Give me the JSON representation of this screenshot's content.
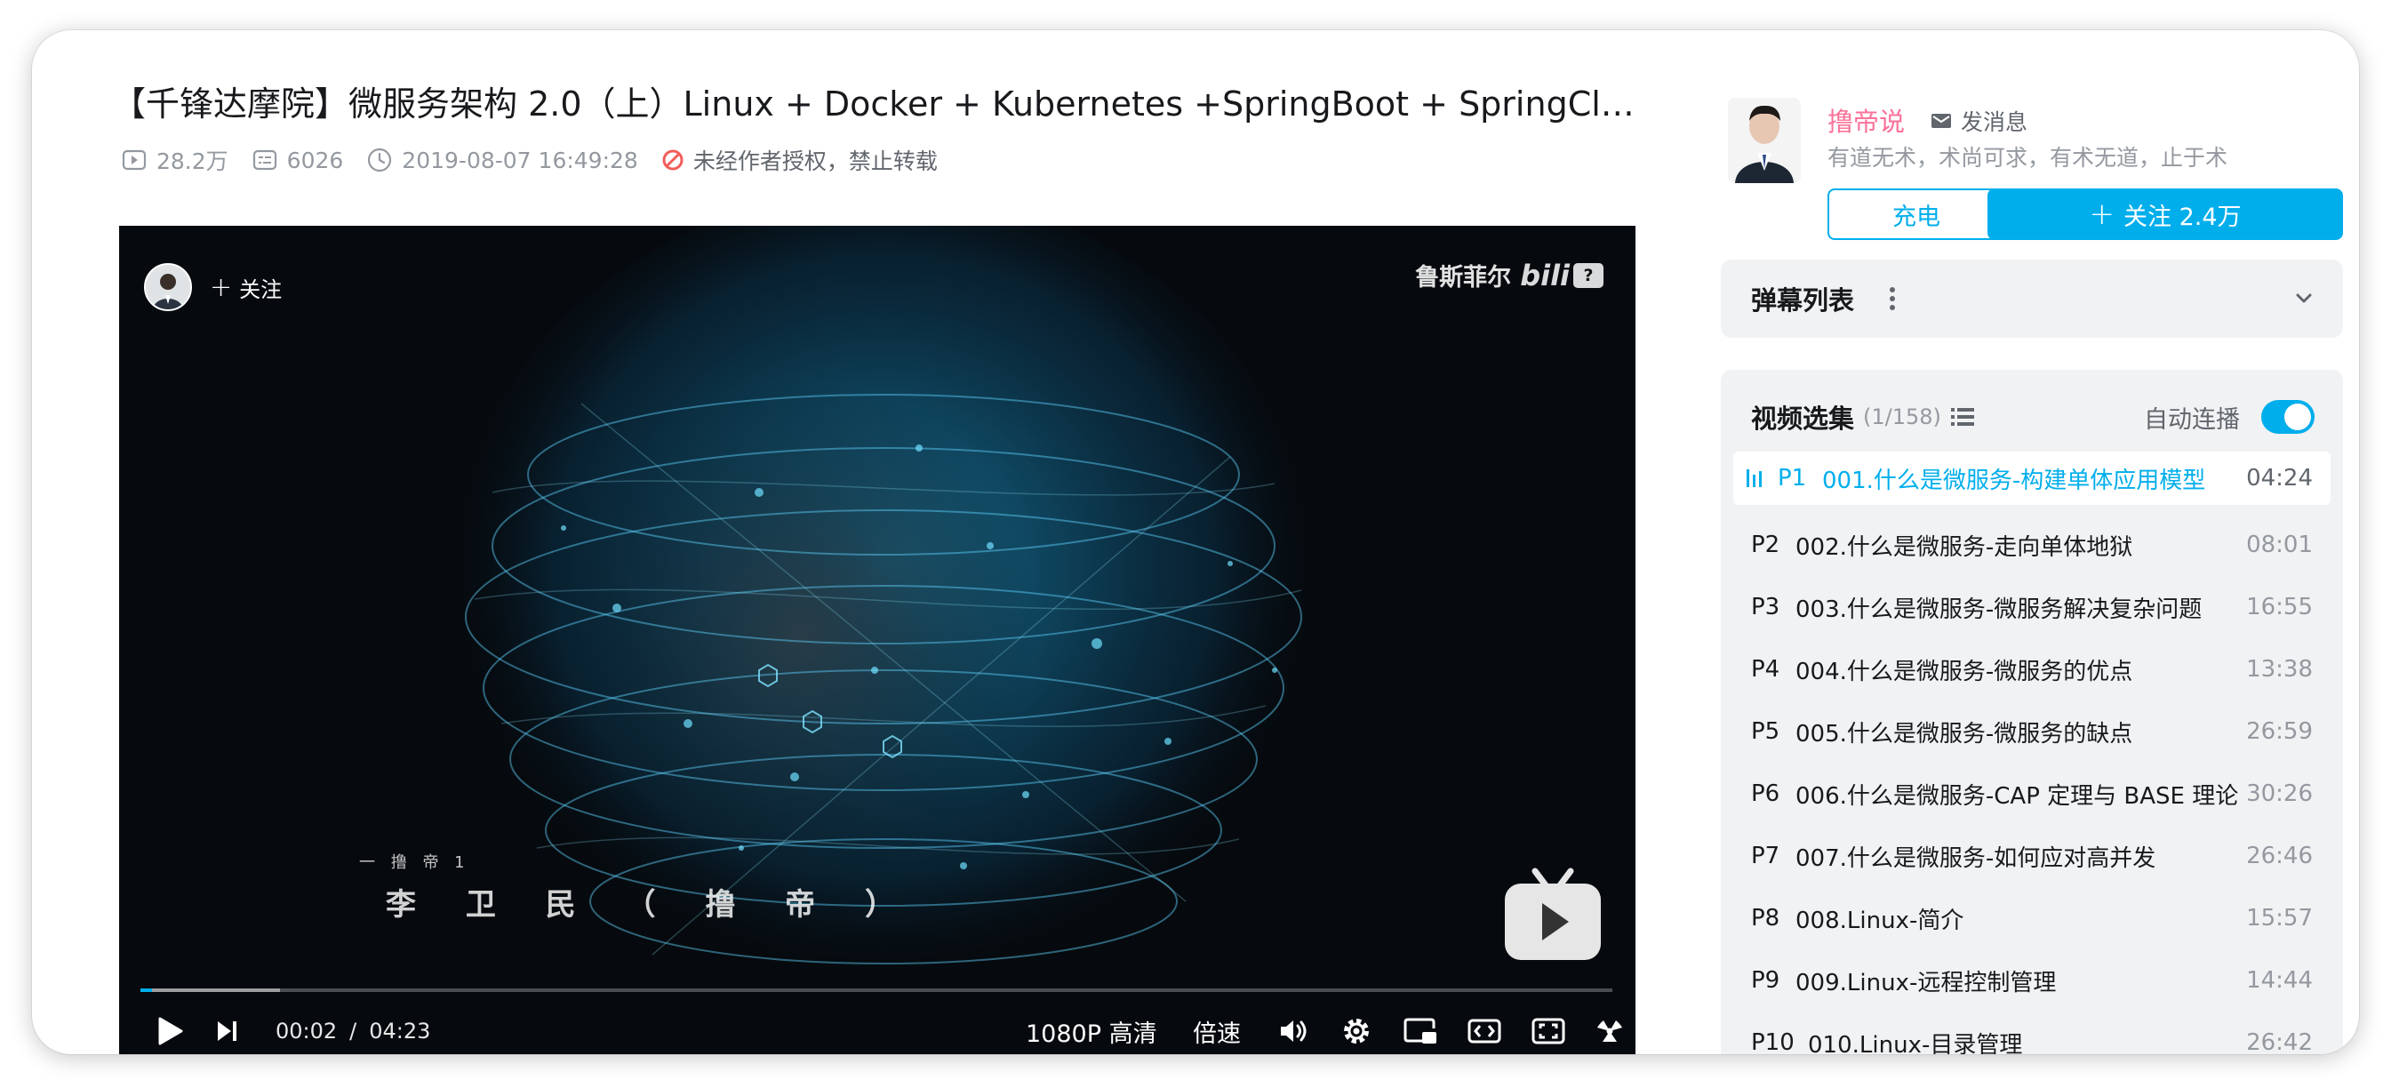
{
  "video": {
    "title": "【千锋达摩院】微服务架构 2.0（上）Linux + Docker + Kubernetes +SpringBoot + SpringCl…",
    "views": "28.2万",
    "danmaku_count": "6026",
    "publish_time": "2019-08-07 16:49:28",
    "copyright_notice": "未经作者授权，禁止转载"
  },
  "player": {
    "follow_label": "关注",
    "watermark_text": "鲁斯菲尔",
    "watermark_logo": "bili",
    "danmaku_badge": "?",
    "subtitle_small": "一 撸 帝 1",
    "subtitle_big": "李 卫 民 （ 撸 帝 ）",
    "current_time": "00:02",
    "time_separator": "/",
    "duration": "04:23",
    "progress_fraction": 0.008,
    "buffered_fraction": 0.095,
    "quality_label": "1080P 高清",
    "speed_label": "倍速",
    "accent_color": "#00aeec"
  },
  "uploader": {
    "name": "撸帝说",
    "message_label": "发消息",
    "description": "有道无术，术尚可求，有术无道，止于术",
    "charge_label": "充电",
    "follow_label": "关注 2.4万",
    "name_color": "#fb7299"
  },
  "danmaku_panel": {
    "title": "弹幕列表"
  },
  "episodes": {
    "title": "视频选集",
    "count": "(1/158)",
    "autoplay_label": "自动连播",
    "autoplay_on": true,
    "items": [
      {
        "p": "P1",
        "name": "001.什么是微服务-构建单体应用模型",
        "duration": "04:24",
        "active": true
      },
      {
        "p": "P2",
        "name": "002.什么是微服务-走向单体地狱",
        "duration": "08:01",
        "active": false
      },
      {
        "p": "P3",
        "name": "003.什么是微服务-微服务解决复杂问题",
        "duration": "16:55",
        "active": false
      },
      {
        "p": "P4",
        "name": "004.什么是微服务-微服务的优点",
        "duration": "13:38",
        "active": false
      },
      {
        "p": "P5",
        "name": "005.什么是微服务-微服务的缺点",
        "duration": "26:59",
        "active": false
      },
      {
        "p": "P6",
        "name": "006.什么是微服务-CAP 定理与 BASE 理论",
        "duration": "30:26",
        "active": false
      },
      {
        "p": "P7",
        "name": "007.什么是微服务-如何应对高并发",
        "duration": "26:46",
        "active": false
      },
      {
        "p": "P8",
        "name": "008.Linux-简介",
        "duration": "15:57",
        "active": false
      },
      {
        "p": "P9",
        "name": "009.Linux-远程控制管理",
        "duration": "14:44",
        "active": false
      },
      {
        "p": "P10",
        "name": "010.Linux-目录管理",
        "duration": "26:42",
        "active": false
      }
    ]
  }
}
